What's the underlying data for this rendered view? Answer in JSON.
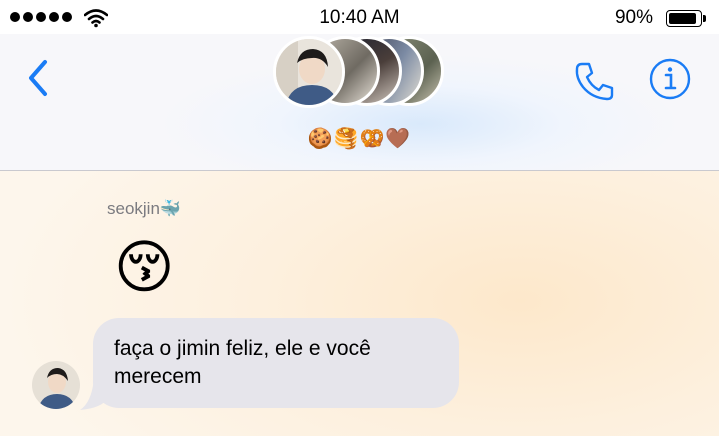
{
  "status_bar": {
    "time": "10:40 AM",
    "battery_percent": "90%",
    "battery_level": 0.9,
    "signal_bars": 5,
    "icons": [
      "signal-dots-icon",
      "wifi-icon",
      "battery-icon"
    ]
  },
  "header": {
    "group_name_emojis": "🍪🥞🥨🤎",
    "icons": [
      "chevron-left-icon",
      "phone-icon",
      "info-icon"
    ],
    "accent_color": "#1a7cf5"
  },
  "chat": {
    "sender_name": "seokjin🐳",
    "emoji_message": "😚",
    "text_message": "faça o jimin feliz, ele e você merecem",
    "bubble_color": "#e6e5eb"
  }
}
